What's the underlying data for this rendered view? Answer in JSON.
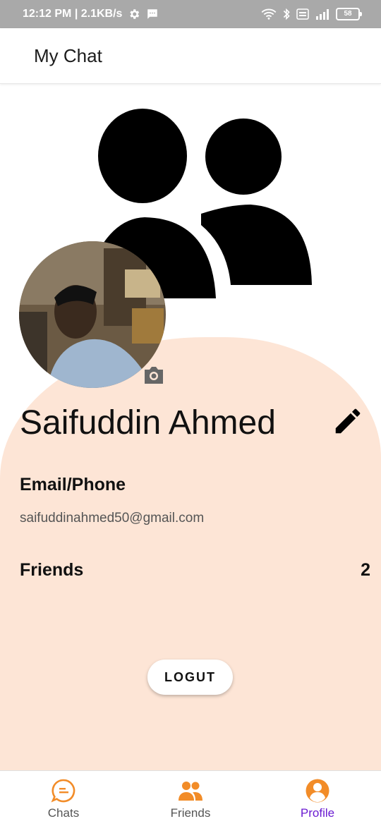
{
  "status_bar": {
    "time": "12:12 PM | 2.1KB/s",
    "battery": "58"
  },
  "app_bar": {
    "title": "My Chat"
  },
  "profile": {
    "name": "Saifuddin Ahmed",
    "email_label": "Email/Phone",
    "email": "saifuddinahmed50@gmail.com",
    "friends_label": "Friends",
    "friends_count": "2"
  },
  "logout_label": "LOGUT",
  "bottom_nav": {
    "items": [
      {
        "label": "Chats",
        "icon": "chat-bubble-icon"
      },
      {
        "label": "Friends",
        "icon": "people-icon"
      },
      {
        "label": "Profile",
        "icon": "account-icon",
        "active": true
      }
    ]
  },
  "colors": {
    "accent": "#f28c28",
    "active_label": "#6a1bd1",
    "card_background": "#fde5d6",
    "status_bar": "#a9a9a9"
  }
}
